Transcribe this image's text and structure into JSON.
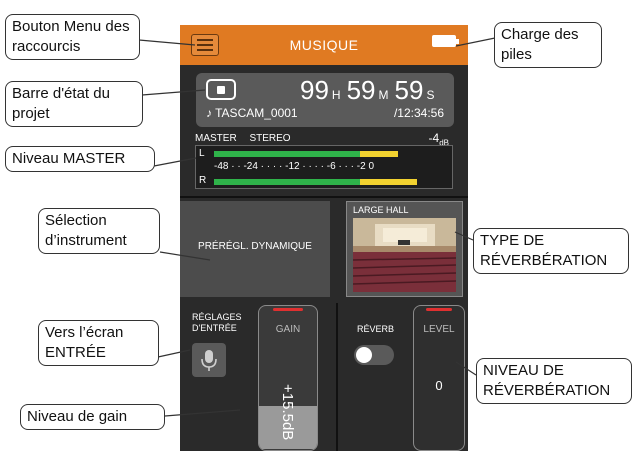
{
  "device": {
    "title": "MUSIQUE",
    "menu_icon": "hamburger-menu-icon",
    "battery_icon": "battery-full-icon",
    "status": {
      "stop_icon": "stop-icon",
      "hours": "99",
      "hours_unit": "H",
      "minutes": "59",
      "minutes_unit": "M",
      "seconds": "59",
      "seconds_unit": "S",
      "project_name": "♪ TASCAM_0001",
      "total_time": "/12:34:56"
    },
    "meter": {
      "master_label": "MASTER",
      "mode_label": "STEREO",
      "level_value": "-4",
      "level_unit": "dB",
      "channel_l": "L",
      "channel_r": "R",
      "scale": "-48 · · -24 · · · · -12 · · · · -6 · · · -2 0",
      "l_level": 0.78,
      "r_level": 0.86
    },
    "preset": {
      "label": "PRÉRÉGL. DYNAMIQUE"
    },
    "reverb": {
      "type_label": "LARGE HALL"
    },
    "input": {
      "label": "RÉGLAGES D'ENTRÉE",
      "mic_icon": "microphone-icon"
    },
    "gain": {
      "label": "GAIN",
      "value": "+15.5dB",
      "fill_fraction": 0.3
    },
    "reverb_toggle": {
      "label": "RÉVERB",
      "on": false
    },
    "level": {
      "label": "LEVEL",
      "value": "0"
    }
  },
  "callouts": {
    "menu_button": "Bouton Menu des raccourcis",
    "status_bar": "Barre d'état du projet",
    "master_level": "Niveau MASTER",
    "instrument": "Sélection d’instrument",
    "input_screen": "Vers l’écran ENTRÉE",
    "gain_level": "Niveau de gain",
    "battery": "Charge des piles",
    "reverb_type": "TYPE DE RÉVERBÉRATION",
    "reverb_level": "NIVEAU DE RÉVERBÉRATION"
  },
  "colors": {
    "header": "#e07a22",
    "screen_bg": "#2a2a2a",
    "meter_green": "#2fb34a",
    "meter_yellow": "#f2d230",
    "meter_orange": "#ef8a1f",
    "fader_red": "#e03030"
  }
}
